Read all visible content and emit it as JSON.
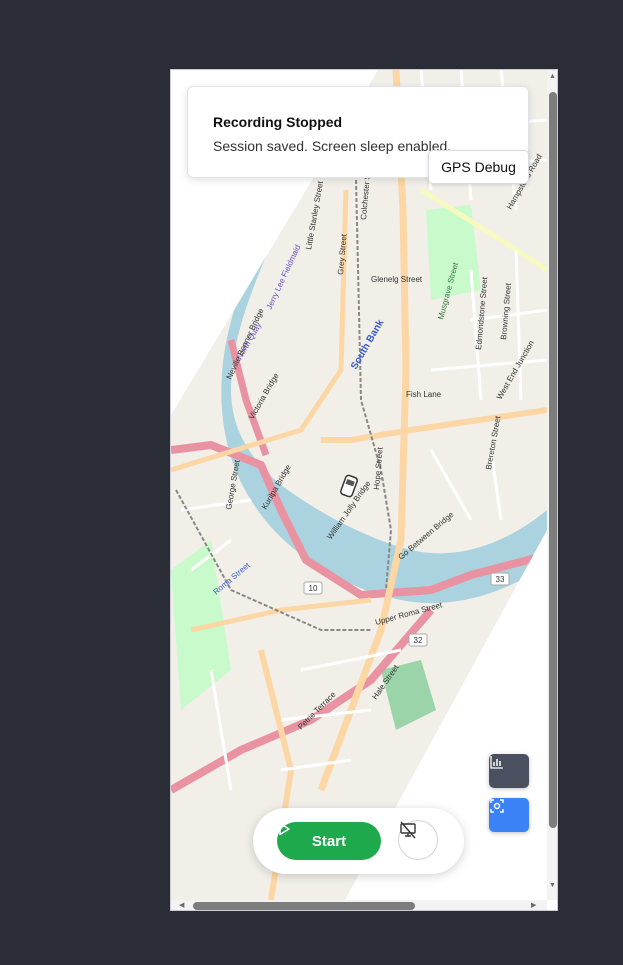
{
  "toast": {
    "title": "Recording Stopped",
    "message": "Session saved. Screen sleep enabled."
  },
  "gps_debug_label": "GPS Debug",
  "controls": {
    "start_label": "Start"
  },
  "map": {
    "street_labels": [
      "Little Stanley Street",
      "Grey Street",
      "Glenelg Street",
      "Colchester Street",
      "South Bank",
      "Jerry Lee Fieldmaid",
      "North Quay",
      "Neville Bonner Bridge",
      "Victoria Bridge",
      "Kurilpa Bridge",
      "George Street",
      "William Jolly Bridge",
      "Roma Street",
      "Go Between Bridge",
      "Hope Street",
      "Upper Roma Street",
      "Hale Street",
      "Petrie Terrace",
      "Edmondstone Street",
      "Browning Street",
      "West End Junction",
      "Brereton Street",
      "Fish Lane",
      "Musgrave Street",
      "Hampstead Road"
    ],
    "road_shields": [
      "33",
      "32",
      "10"
    ]
  },
  "colors": {
    "background": "#2a2d35",
    "water": "#aad3df",
    "park": "#c8facc",
    "major_road": "#e892a2",
    "secondary_road": "#fcd6a4",
    "start_button": "#1fa94d",
    "focus_button": "#3b82f6",
    "stats_button": "#4a5060"
  },
  "icons": {
    "start": "play-icon",
    "screen_sleep": "monitor-off-icon",
    "stats": "bar-chart-icon",
    "focus": "focus-locate-icon",
    "vehicle": "car-icon"
  }
}
